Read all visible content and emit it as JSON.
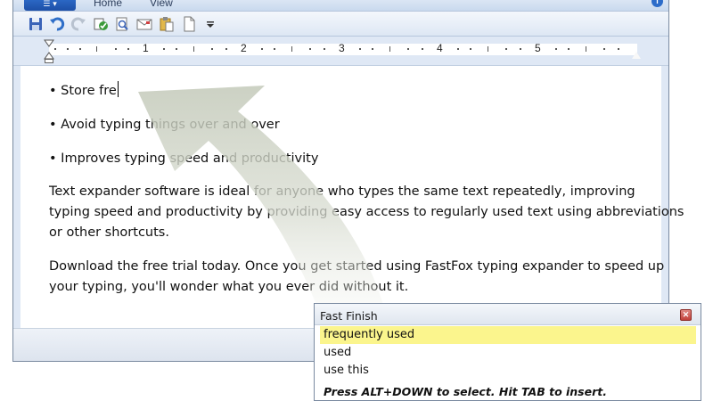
{
  "ribbon": {
    "tabs": [
      "Home",
      "View"
    ]
  },
  "quick_access": {
    "icons": [
      "save-icon",
      "undo-icon",
      "redo-icon",
      "spellcheck-icon",
      "print-preview-icon",
      "envelope-icon",
      "paste-icon",
      "new-document-icon",
      "customize-dropdown-icon"
    ]
  },
  "ruler": {
    "numbers": [
      "1",
      "2",
      "3",
      "4",
      "5"
    ]
  },
  "document": {
    "bullets": [
      "• Store fre",
      "• Avoid typing things over and over",
      "• Improves typing speed and productivity"
    ],
    "paragraph1": [
      "Text expander software is ideal for anyone who types the same text repeatedly, improving",
      "typing speed and productivity by providing easy access to regularly used text using abbreviations",
      "or other shortcuts."
    ],
    "paragraph2": [
      "Download the free trial today. Once you get started using FastFox typing expander to speed up",
      "your typing, you'll wonder what you ever did without it."
    ]
  },
  "popup": {
    "title": "Fast Finish",
    "suggestions": [
      "frequently used",
      "used",
      "use this"
    ],
    "selected_index": 0,
    "hint": "Press ALT+DOWN to select. Hit TAB to insert."
  },
  "colors": {
    "selection": "#fbf58d",
    "file_tab": "#1d4fa6",
    "window_chrome": "#dfe8f5"
  }
}
